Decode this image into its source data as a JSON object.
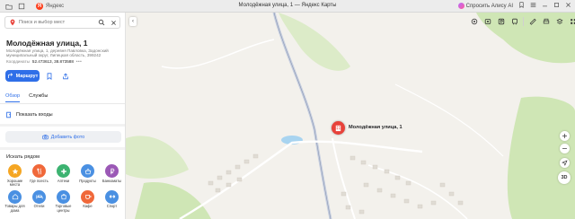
{
  "browser": {
    "brand": "Яндекс",
    "window_title": "Молодёжная улица, 1 — Яндекс Карты",
    "alisa_label": "Спросить Алису AI"
  },
  "search": {
    "placeholder": "Поиск и выбор мест"
  },
  "place": {
    "title": "Молодёжная улица, 1",
    "address": "Молодёжная улица, 1, деревня Павловка, Задонский муниципальный округ, Липецкая область, 399242",
    "coords_label": "Координаты",
    "coords_value": "52.473613, 38.873588",
    "coords_more": "•••"
  },
  "actions": {
    "route_label": "Маршрут"
  },
  "tabs": [
    {
      "label": "Обзор",
      "active": true
    },
    {
      "label": "Службы",
      "active": false
    }
  ],
  "entrances_label": "Показать входы",
  "add_photo_label": "Добавить фото",
  "nearby": {
    "title": "Искать рядом",
    "categories": [
      {
        "label": "Хорошие места",
        "color": "#f5a623",
        "icon": "star-icon"
      },
      {
        "label": "Где поесть",
        "color": "#f0683a",
        "icon": "fork-knife-icon"
      },
      {
        "label": "Аптеки",
        "color": "#3cb371",
        "icon": "pharmacy-cross-icon"
      },
      {
        "label": "Продукты",
        "color": "#4a90e2",
        "icon": "basket-icon"
      },
      {
        "label": "Банкоматы",
        "color": "#9b59b6",
        "icon": "ruble-icon"
      },
      {
        "label": "Товары для дома",
        "color": "#4a90e2",
        "icon": "home-goods-icon"
      },
      {
        "label": "Отели",
        "color": "#4a90e2",
        "icon": "bed-icon"
      },
      {
        "label": "Торговые центры",
        "color": "#4a90e2",
        "icon": "shopping-bag-icon"
      },
      {
        "label": "Кафе",
        "color": "#f0683a",
        "icon": "coffee-cup-icon"
      },
      {
        "label": "Спорт",
        "color": "#4a90e2",
        "icon": "dumbbell-icon"
      }
    ]
  },
  "map": {
    "marker_label": "Молодёжная улица, 1",
    "view_3d_label": "3D",
    "colors": {
      "marker": "#e8423a",
      "road": "#c7cfe0",
      "field": "#f3f1ec",
      "forest": "#cfe6b5",
      "water": "#a8d4f0",
      "accent": "#2f6fe8"
    }
  }
}
